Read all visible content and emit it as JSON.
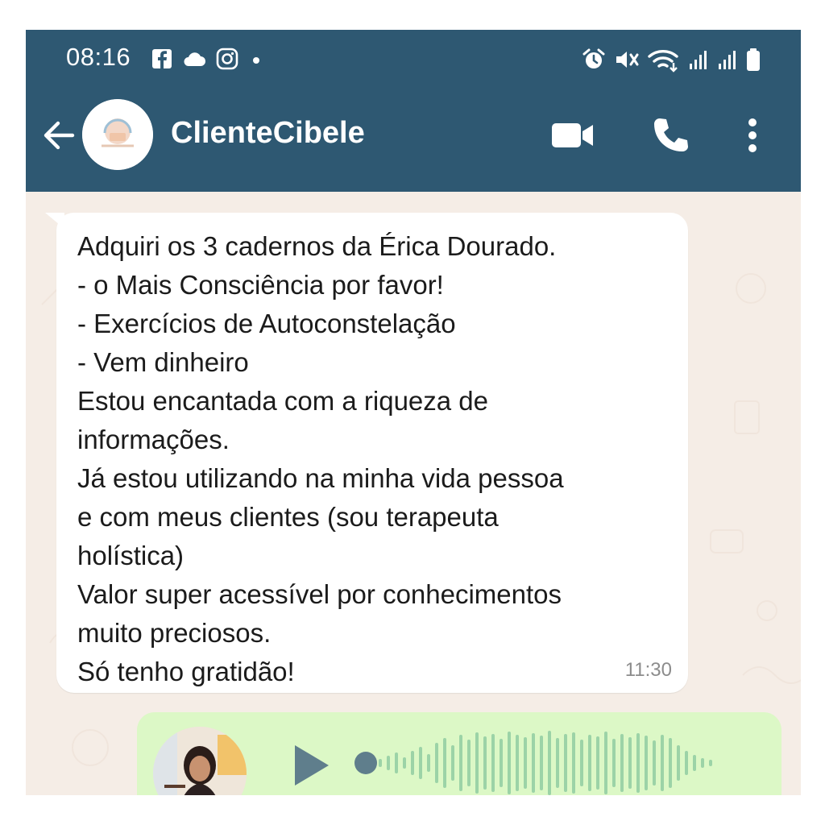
{
  "status_bar": {
    "time": "08:16",
    "left_icons": [
      "facebook-icon",
      "cloud-icon",
      "instagram-icon",
      "dot-icon"
    ],
    "right_icons": [
      "alarm-icon",
      "mute-icon",
      "wifi-icon",
      "signal-icon",
      "signal-icon",
      "battery-icon"
    ]
  },
  "header": {
    "contact_name": "ClienteCibele",
    "icons": [
      "back-arrow-icon",
      "video-call-icon",
      "phone-call-icon",
      "more-options-icon"
    ],
    "bar_color": "#2e5872"
  },
  "messages": {
    "incoming": {
      "lines": [
        "Adquiri os 3 cadernos da Érica Dourado.",
        "- o Mais Consciência por favor!",
        "- Exercícios de Autoconstelação",
        "- Vem dinheiro",
        "Estou encantada com a riqueza de",
        "informações.",
        "Já estou utilizando na minha vida pessoa",
        "e com meus clientes (sou terapeuta",
        "holística)",
        "Valor super acessível por conhecimentos",
        "muito preciosos.",
        "Só tenho gratidão!"
      ],
      "time": "11:30",
      "bubble_color": "#ffffff"
    },
    "outgoing_voice": {
      "bubble_color": "#dcf8c6",
      "icons": [
        "play-icon",
        "waveform-icon"
      ],
      "played_fraction": 0
    }
  },
  "colors": {
    "chat_background": "#f5ede6",
    "waveform": "#9cd3a7",
    "play_button": "#5f7e8c"
  }
}
